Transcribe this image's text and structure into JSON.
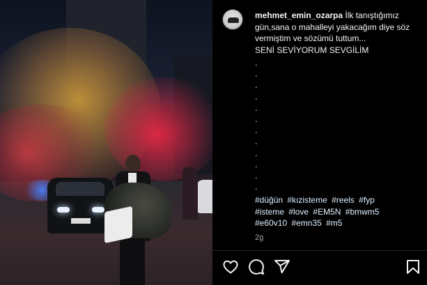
{
  "post": {
    "username": "mehmet_emin_ozarpa",
    "caption_line1": "İlk tanıştığımız gün,sana o mahalleyi yakacağım diye söz vermiştim ve sözümü tuttum...",
    "caption_line2": "SENİ SEVİYORUM SEVGİLİM",
    "dots": [
      ".",
      ".",
      ".",
      ".",
      ".",
      ".",
      ".",
      ".",
      ".",
      ".",
      ".",
      "."
    ],
    "hashtags": [
      "#düğün",
      "#kızisteme",
      "#reels",
      "#fyp",
      "#isteme",
      "#love",
      "#EM5N",
      "#bmwm5",
      "#e60v10",
      "#emn35",
      "#m5"
    ],
    "time_ago": "2g"
  },
  "actions": {
    "like_icon": "heart-icon",
    "comment_icon": "comment-icon",
    "share_icon": "share-icon",
    "save_icon": "bookmark-icon"
  },
  "colors": {
    "background": "#000000",
    "text": "#f5f5f5",
    "hashtag": "#e0f1ff",
    "muted": "#a8a8a8"
  }
}
